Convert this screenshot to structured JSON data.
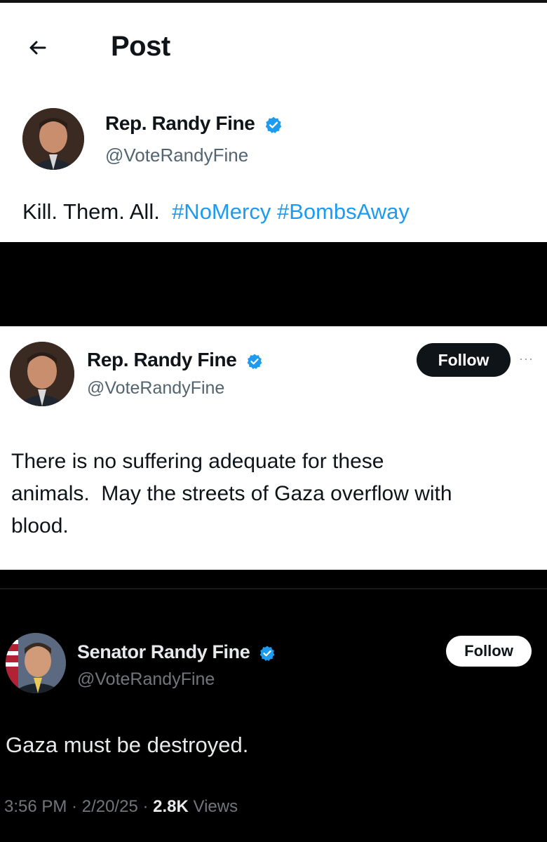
{
  "panel1": {
    "header_title": "Post",
    "author_name": "Rep. Randy Fine",
    "author_handle": "@VoteRandyFine",
    "text_plain": "Kill. Them. All.",
    "hashtags": [
      "#NoMercy",
      "#BombsAway"
    ]
  },
  "panel2": {
    "author_name": "Rep. Randy Fine",
    "author_handle": "@VoteRandyFine",
    "follow_label": "Follow",
    "more_label": "···",
    "text_line1": "There is no suffering adequate for these",
    "text_line2": "animals.  May the streets of Gaza overflow with",
    "text_line3": "blood."
  },
  "panel3": {
    "author_name": "Senator Randy Fine",
    "author_handle": "@VoteRandyFine",
    "follow_label": "Follow",
    "text": "Gaza must be destroyed.",
    "time": "3:56 PM",
    "date": "2/20/25",
    "views_count": "2.8K",
    "views_label": "Views"
  },
  "icons": {
    "back": "back-arrow-icon",
    "verified": "verified-badge-icon",
    "more": "more-options-icon"
  },
  "colors": {
    "verified_blue": "#1d9bf0",
    "hashtag_blue": "#1d9bf0",
    "text_light": "#0f1419",
    "text_dark": "#e7e9ea",
    "muted": "#536471"
  }
}
